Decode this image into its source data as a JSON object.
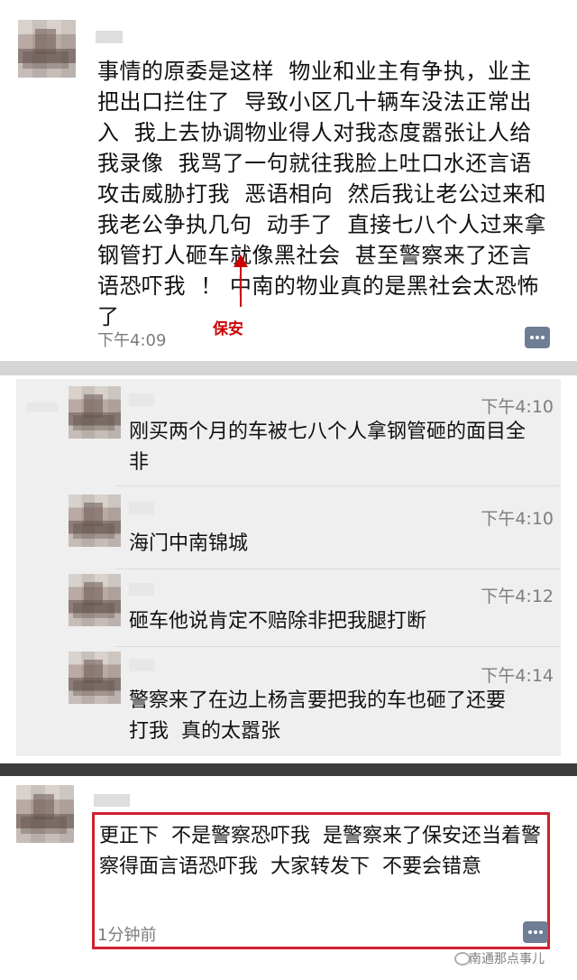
{
  "post": {
    "text": "事情的原委是这样  物业和业主有争执，业主把出口拦住了  导致小区几十辆车没法正常出入  我上去协调物业得人对我态度嚣张让人给我录像  我骂了一句就往我脸上吐口水还言语攻击威胁打我  恶语相向  然后我让老公过来和我老公争执几句  动手了  直接七八个人过来拿钢管打人砸车就像黑社会  甚至警察来了还言语恐吓我  ！ 中南的物业真的是黑社会太恐怖了",
    "time": "下午4:09",
    "annotation": "保安"
  },
  "comments": [
    {
      "time": "下午4:10",
      "text": "刚买两个月的车被七八个人拿钢管砸的面目全非"
    },
    {
      "time": "下午4:10",
      "text": "海门中南锦城"
    },
    {
      "time": "下午4:12",
      "text": "砸车他说肯定不赔除非把我腿打断"
    },
    {
      "time": "下午4:14",
      "text": "警察来了在边上杨言要把我的车也砸了还要打我  真的太嚣张"
    }
  ],
  "repost": {
    "text": "更正下  不是警察恐吓我  是警察来了保安还当着警察得面言语恐吓我  大家转发下  不要会错意",
    "time": "1分钟前"
  },
  "watermark": "南通那点事儿",
  "colors": {
    "highlight": "#d0222f",
    "annotation": "#cc0000",
    "comment_icon": "#6f7d95"
  }
}
